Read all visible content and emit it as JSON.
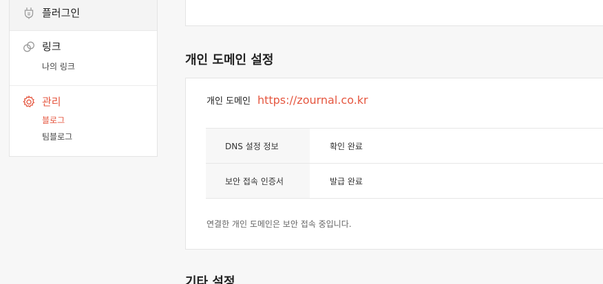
{
  "sidebar": {
    "plugin": {
      "title": "플러그인",
      "icon": "plug-icon"
    },
    "link": {
      "title": "링크",
      "icon": "link-icon",
      "items": [
        "나의 링크"
      ]
    },
    "manage": {
      "title": "관리",
      "icon": "gear-icon",
      "items": [
        "블로그",
        "팀블로그"
      ],
      "accent": "#e5563f"
    }
  },
  "main": {
    "section_title": "개인 도메인 설정",
    "domain": {
      "label": "개인 도메인",
      "url": "https://zournal.co.kr"
    },
    "rows": [
      {
        "key": "DNS 설정 정보",
        "value": "확인 완료"
      },
      {
        "key": "보안 접속 인증서",
        "value": "발급 완료"
      }
    ],
    "note": "연결한 개인 도메인은 보안 접속 중입니다.",
    "next_section_title": "기타 설정"
  }
}
